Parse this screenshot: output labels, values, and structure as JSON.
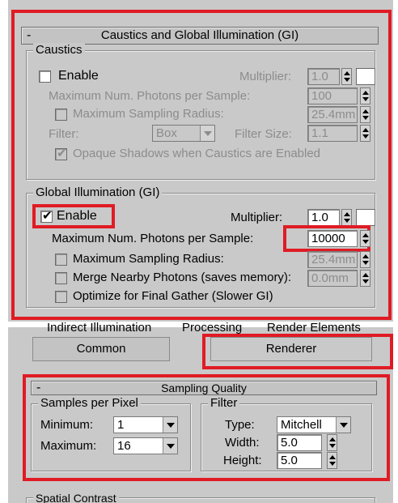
{
  "top_panel": {
    "rollout_title": "Caustics and Global Illumination (GI)",
    "collapse_symbol": "-",
    "caustics": {
      "legend": "Caustics",
      "enable_label": "Enable",
      "enable_checked": false,
      "multiplier_label": "Multiplier:",
      "multiplier_value": "1.0",
      "photons_label": "Maximum Num. Photons per Sample:",
      "photons_value": "100",
      "max_radius_label": "Maximum Sampling Radius:",
      "max_radius_value": "25.4mm",
      "filter_label": "Filter:",
      "filter_value": "Box",
      "filter_size_label": "Filter Size:",
      "filter_size_value": "1.1",
      "opaque_label": "Opaque Shadows when Caustics are Enabled",
      "opaque_checked": true
    },
    "gi": {
      "legend": "Global Illumination (GI)",
      "enable_label": "Enable",
      "enable_checked": true,
      "multiplier_label": "Multiplier:",
      "multiplier_value": "1.0",
      "photons_label": "Maximum Num. Photons per Sample:",
      "photons_value": "10000",
      "max_radius_label": "Maximum Sampling Radius:",
      "max_radius_value": "25.4mm",
      "merge_label": "Merge Nearby Photons (saves memory):",
      "merge_value": "0.0mm",
      "optimize_label": "Optimize for Final Gather (Slower GI)"
    },
    "check_mark": "✔"
  },
  "bottom_panel": {
    "tabs_cut": [
      "Indirect Illumination",
      "Processing",
      "Render Elements"
    ],
    "tab_common": "Common",
    "tab_renderer": "Renderer",
    "rollout_title": "Sampling Quality",
    "collapse_symbol": "-",
    "samples": {
      "legend": "Samples per Pixel",
      "min_label": "Minimum:",
      "min_value": "1",
      "max_label": "Maximum:",
      "max_value": "16"
    },
    "filter": {
      "legend": "Filter",
      "type_label": "Type:",
      "type_value": "Mitchell",
      "width_label": "Width:",
      "width_value": "5.0",
      "height_label": "Height:",
      "height_value": "5.0"
    },
    "spatial_legend": "Spatial Contrast"
  },
  "colors": {
    "highlight": "#e01b24",
    "panel_bg": "#c9c9c9"
  }
}
